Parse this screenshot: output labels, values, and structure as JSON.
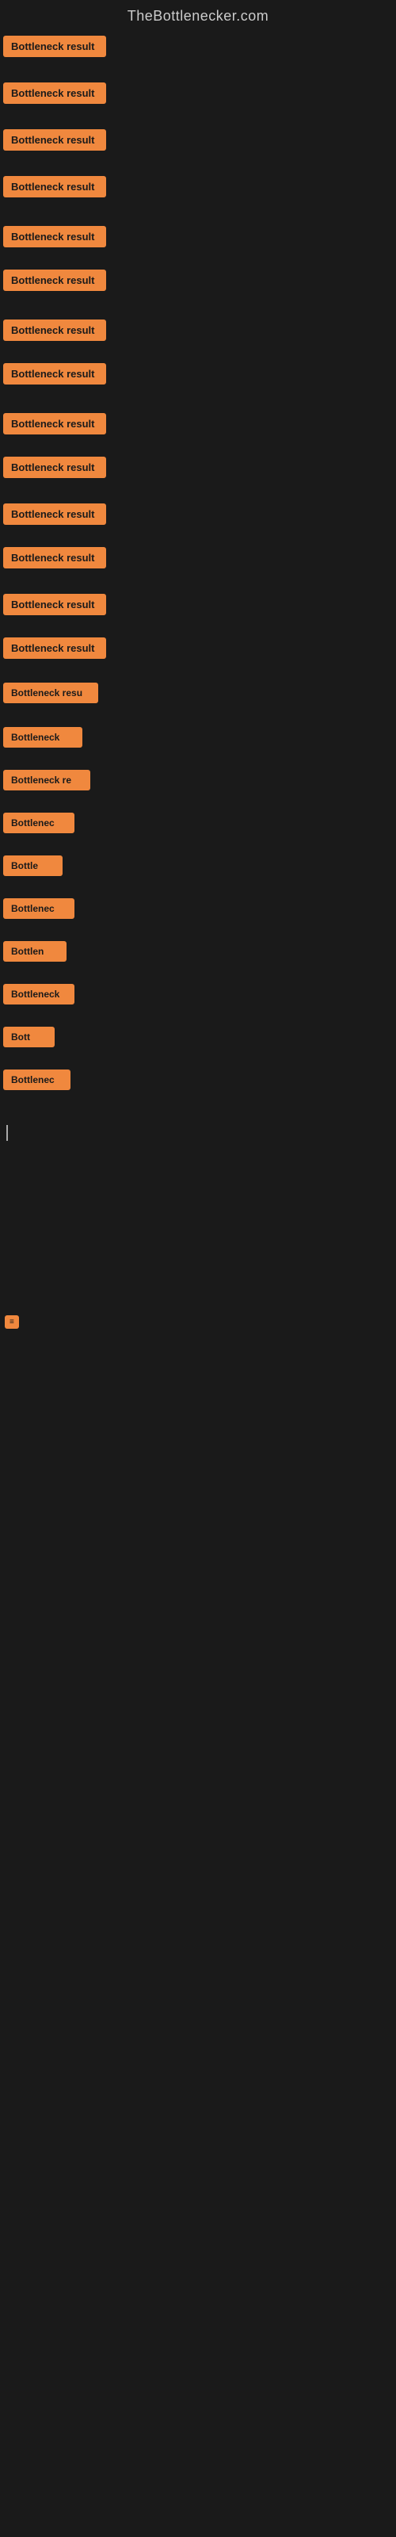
{
  "site": {
    "title": "TheBottlenecker.com"
  },
  "rows": [
    {
      "id": 1,
      "label": "Bottleneck result",
      "visible": true
    },
    {
      "id": 2,
      "label": "Bottleneck result",
      "visible": true
    },
    {
      "id": 3,
      "label": "Bottleneck result",
      "visible": true
    },
    {
      "id": 4,
      "label": "Bottleneck result",
      "visible": true
    },
    {
      "id": 5,
      "label": "Bottleneck result",
      "visible": true
    },
    {
      "id": 6,
      "label": "Bottleneck result",
      "visible": true
    },
    {
      "id": 7,
      "label": "Bottleneck result",
      "visible": true
    },
    {
      "id": 8,
      "label": "Bottleneck result",
      "visible": true
    },
    {
      "id": 9,
      "label": "Bottleneck result",
      "visible": true
    },
    {
      "id": 10,
      "label": "Bottleneck result",
      "visible": true
    },
    {
      "id": 11,
      "label": "Bottleneck result",
      "visible": true
    },
    {
      "id": 12,
      "label": "Bottleneck result",
      "visible": true
    },
    {
      "id": 13,
      "label": "Bottleneck result",
      "visible": true
    },
    {
      "id": 14,
      "label": "Bottleneck result",
      "visible": true
    },
    {
      "id": 15,
      "label": "Bottleneck resu",
      "visible": true
    },
    {
      "id": 16,
      "label": "Bottleneck",
      "visible": true
    },
    {
      "id": 17,
      "label": "Bottleneck re",
      "visible": true
    },
    {
      "id": 18,
      "label": "Bottlenec",
      "visible": true
    },
    {
      "id": 19,
      "label": "Bottle",
      "visible": true
    },
    {
      "id": 20,
      "label": "Bottlenec",
      "visible": true
    },
    {
      "id": 21,
      "label": "Bottlen",
      "visible": true
    },
    {
      "id": 22,
      "label": "Bottleneck",
      "visible": true
    },
    {
      "id": 23,
      "label": "Bott",
      "visible": true
    },
    {
      "id": 24,
      "label": "Bottlenec",
      "visible": true
    }
  ],
  "colors": {
    "badge_bg": "#f0883e",
    "background": "#1a1a1a",
    "title": "#cccccc"
  }
}
